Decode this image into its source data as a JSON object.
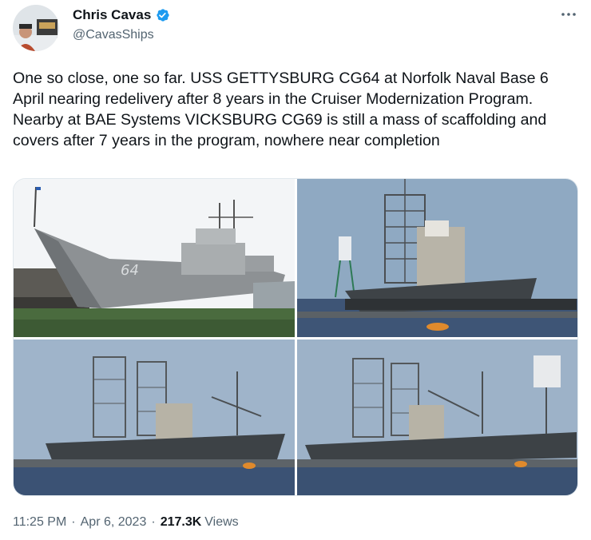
{
  "author": {
    "name": "Chris Cavas",
    "handle": "@CavasShips",
    "verified": true
  },
  "tweet": {
    "text": "One so close, one so far. USS GETTYSBURG CG64 at Norfolk Naval Base 6 April nearing redelivery after 8 years in the Cruiser Modernization Program. Nearby at BAE Systems VICKSBURG CG69 is still a mass of scaffolding and covers after 7 years in the program, nowhere near completion"
  },
  "photo1": {
    "hull_number": "64"
  },
  "meta": {
    "time": "11:25 PM",
    "separator": "·",
    "date": "Apr 6, 2023",
    "views_count": "217.3K",
    "views_label": "Views"
  },
  "colors": {
    "accent": "#1d9bf0",
    "text": "#0f1419",
    "secondary": "#536471"
  },
  "icons": {
    "verified": "verified-badge-icon",
    "more": "more-options-icon"
  }
}
